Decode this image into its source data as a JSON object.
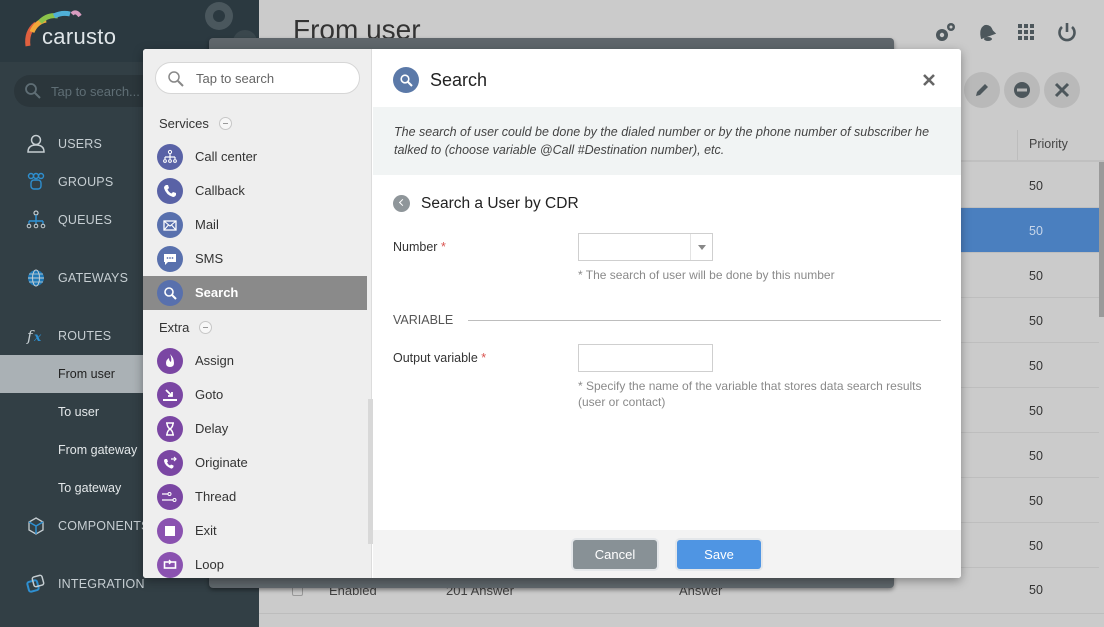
{
  "app": {
    "brand": "carusto"
  },
  "sidebar": {
    "search_placeholder": "Tap to search...",
    "nav": [
      {
        "label": "USERS",
        "icon": "user-icon"
      },
      {
        "label": "GROUPS",
        "icon": "groups-icon"
      },
      {
        "label": "QUEUES",
        "icon": "queues-icon"
      },
      {
        "label": "GATEWAYS",
        "icon": "globe-icon"
      },
      {
        "label": "ROUTES",
        "icon": "fx-icon"
      },
      {
        "label": "COMPONENTS",
        "icon": "cube-icon"
      },
      {
        "label": "INTEGRATION",
        "icon": "integration-icon"
      }
    ],
    "routes_sub": [
      {
        "label": "From user",
        "active": true
      },
      {
        "label": "To user"
      },
      {
        "label": "From gateway"
      },
      {
        "label": "To gateway"
      }
    ]
  },
  "main": {
    "page_title": "From user",
    "top_icons": [
      "settings-icon",
      "bell-icon",
      "apps-grid-icon",
      "power-icon"
    ],
    "actions": [
      "edit-icon",
      "disable-icon",
      "delete-icon"
    ],
    "table": {
      "priority_header": "Priority",
      "priorities": [
        "50",
        "50",
        "50",
        "50",
        "50",
        "50",
        "50",
        "50",
        "50",
        "50"
      ],
      "selected_index": 1,
      "last_row": {
        "status": "Enabled",
        "code": "201 Answer",
        "action": "Answer",
        "priority": "50"
      }
    }
  },
  "modal": {
    "palette": {
      "search_placeholder": "Tap to search",
      "groups": [
        {
          "label": "Services",
          "items": [
            {
              "label": "Call center",
              "icon": "call-center-icon"
            },
            {
              "label": "Callback",
              "icon": "phone-icon"
            },
            {
              "label": "Mail",
              "icon": "mail-icon"
            },
            {
              "label": "SMS",
              "icon": "sms-icon"
            },
            {
              "label": "Search",
              "icon": "search-icon",
              "active": true
            }
          ]
        },
        {
          "label": "Extra",
          "items": [
            {
              "label": "Assign",
              "icon": "flame-icon"
            },
            {
              "label": "Goto",
              "icon": "goto-icon"
            },
            {
              "label": "Delay",
              "icon": "hourglass-icon"
            },
            {
              "label": "Originate",
              "icon": "originate-icon"
            },
            {
              "label": "Thread",
              "icon": "thread-icon"
            },
            {
              "label": "Exit",
              "icon": "stop-icon"
            },
            {
              "label": "Loop",
              "icon": "loop-icon"
            }
          ]
        }
      ]
    },
    "title": "Search",
    "description": "The search of user could be done by the dialed number or by the phone number of subscriber he talked to (choose variable @Call #Destination number), etc.",
    "section_title": "Search a User by CDR",
    "fields": {
      "number": {
        "label": "Number",
        "required": "*",
        "value": "",
        "hint": "* The search of user will be done by this number"
      },
      "variable_header": "VARIABLE",
      "output_variable": {
        "label": "Output variable",
        "required": "*",
        "value": "",
        "hint": "* Specify the name of the variable that stores data search results (user or contact)"
      }
    },
    "buttons": {
      "cancel": "Cancel",
      "save": "Save"
    }
  },
  "colors": {
    "accent": "#4f95e3",
    "selected_row": "#4a7fbf",
    "sidebar_bg": "#323f45"
  }
}
